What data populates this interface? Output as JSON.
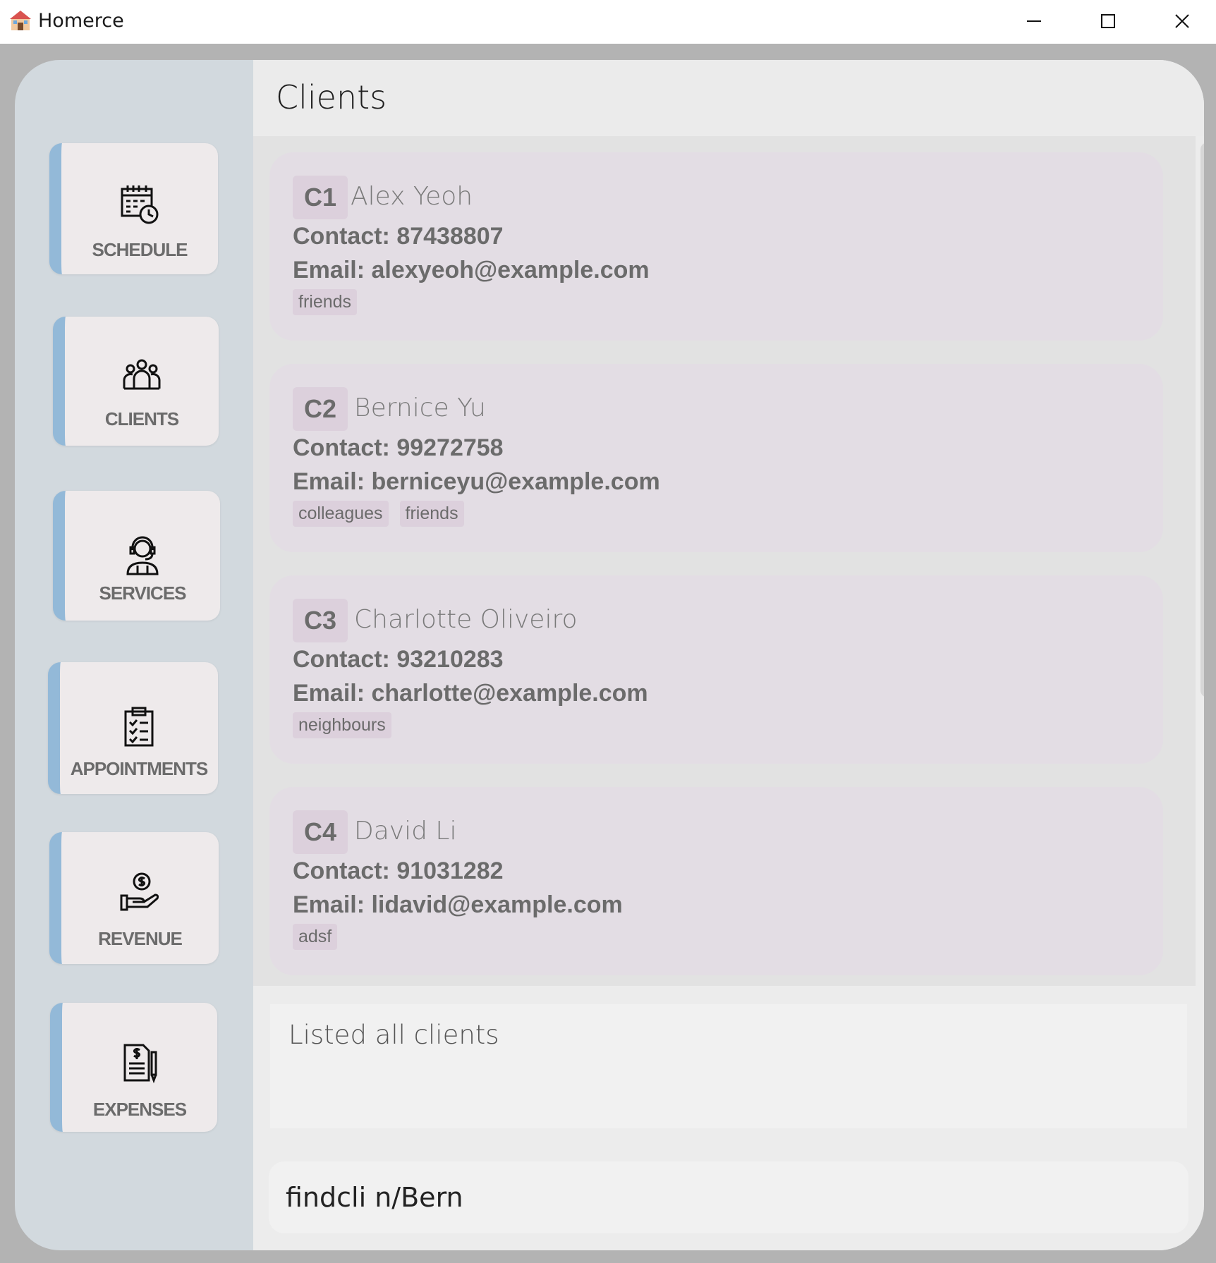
{
  "window": {
    "title": "Homerce",
    "icon": "app-house-icon"
  },
  "sidebar": {
    "items": [
      {
        "label": "SCHEDULE",
        "icon": "calendar-clock-icon"
      },
      {
        "label": "CLIENTS",
        "icon": "people-group-icon"
      },
      {
        "label": "SERVICES",
        "icon": "customer-service-agent-icon"
      },
      {
        "label": "APPOINTMENTS",
        "icon": "clipboard-checklist-icon"
      },
      {
        "label": "REVENUE",
        "icon": "hand-dollar-icon"
      },
      {
        "label": "EXPENSES",
        "icon": "receipt-dollar-pen-icon"
      }
    ],
    "accent_color": "#93b9d8"
  },
  "header": {
    "title": "Clients"
  },
  "clients": [
    {
      "index": "C1",
      "name": "Alex Yeoh",
      "contact": "Contact: 87438807",
      "email": "Email: alexyeoh@example.com",
      "tags": [
        "friends"
      ]
    },
    {
      "index": "C2",
      "name": "Bernice Yu",
      "contact": "Contact: 99272758",
      "email": "Email: berniceyu@example.com",
      "tags": [
        "colleagues",
        "friends"
      ]
    },
    {
      "index": "C3",
      "name": "Charlotte Oliveiro",
      "contact": "Contact: 93210283",
      "email": "Email: charlotte@example.com",
      "tags": [
        "neighbours"
      ]
    },
    {
      "index": "C4",
      "name": "David Li",
      "contact": "Contact: 91031282",
      "email": "Email: lidavid@example.com",
      "tags": [
        "adsf"
      ]
    }
  ],
  "result": {
    "message": "Listed all clients"
  },
  "command": {
    "value": "findcli n/Bern"
  }
}
